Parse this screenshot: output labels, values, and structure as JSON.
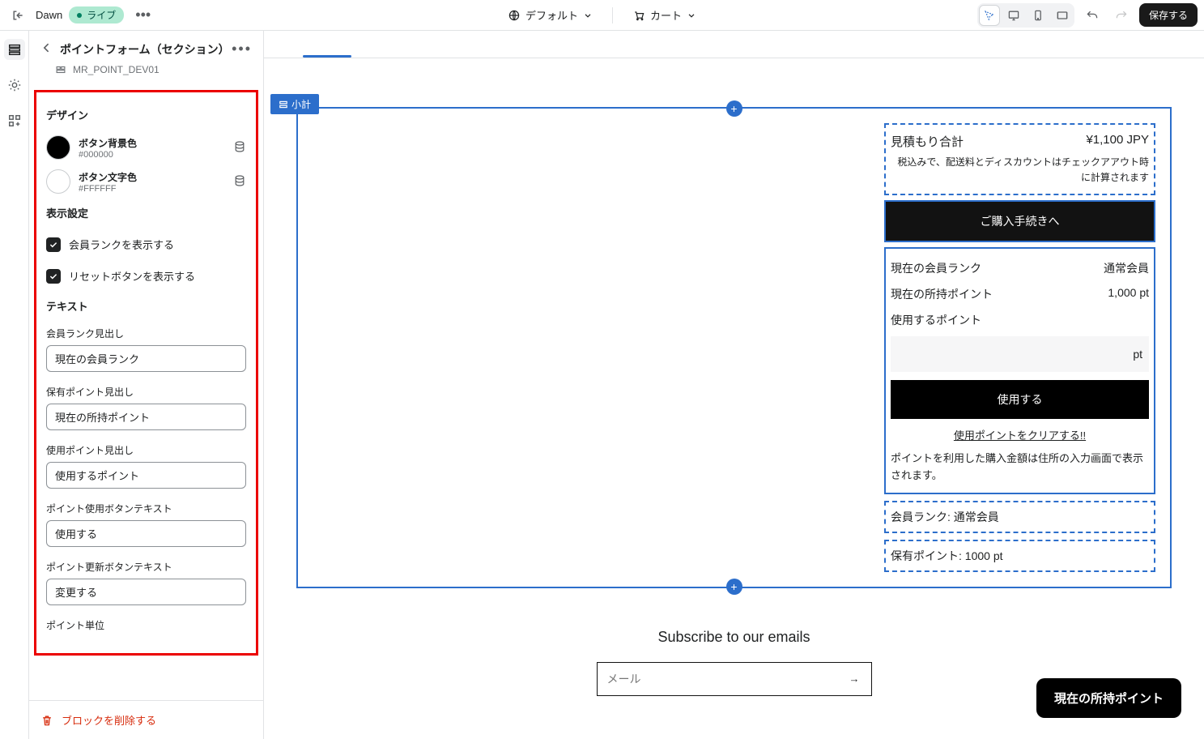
{
  "topbar": {
    "theme_name": "Dawn",
    "live_badge": "ライブ",
    "locale_label": "デフォルト",
    "page_label": "カート",
    "save_label": "保存する"
  },
  "panel": {
    "title": "ポイントフォーム（セクション）",
    "crumb": "MR_POINT_DEV01",
    "design_heading": "デザイン",
    "color_bg_label": "ボタン背景色",
    "color_bg_value": "#000000",
    "color_fg_label": "ボタン文字色",
    "color_fg_value": "#FFFFFF",
    "display_heading": "表示設定",
    "check_rank": "会員ランクを表示する",
    "check_reset": "リセットボタンを表示する",
    "text_heading": "テキスト",
    "f_rank_label": "会員ランク見出し",
    "f_rank_value": "現在の会員ランク",
    "f_owned_label": "保有ポイント見出し",
    "f_owned_value": "現在の所持ポイント",
    "f_use_label": "使用ポイント見出し",
    "f_use_value": "使用するポイント",
    "f_usebtn_label": "ポイント使用ボタンテキスト",
    "f_usebtn_value": "使用する",
    "f_updbtn_label": "ポイント更新ボタンテキスト",
    "f_updbtn_value": "変更する",
    "f_unit_label": "ポイント単位",
    "delete_label": "ブロックを削除する"
  },
  "preview": {
    "section_tag": "小計",
    "est_total_label": "見積もり合計",
    "est_total_value": "¥1,100 JPY",
    "tax_note": "税込みで、配送料とディスカウントはチェックアアウト時に計算されます",
    "checkout_label": "ご購入手続きへ",
    "rank_label": "現在の会員ランク",
    "rank_value": "通常会員",
    "owned_label": "現在の所持ポイント",
    "owned_value": "1,000 pt",
    "use_label": "使用するポイント",
    "pt_unit": "pt",
    "use_btn": "使用する",
    "clear_link": "使用ポイントをクリアする!!",
    "pt_note": "ポイントを利用した購入金額は住所の入力画面で表示されます。",
    "info_rank": "会員ランク: 通常会員",
    "info_owned": "保有ポイント: 1000 pt",
    "subscribe_heading": "Subscribe to our emails",
    "email_placeholder": "メール",
    "floating_chip": "現在の所持ポイント"
  }
}
